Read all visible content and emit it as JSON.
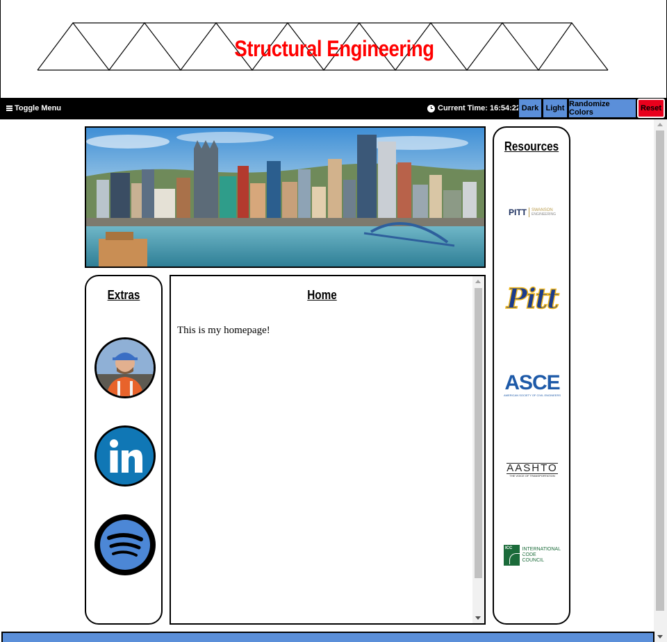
{
  "header": {
    "title": "Structural Engineering",
    "title_color": "#ff0000"
  },
  "navbar": {
    "toggle_label": "Toggle Menu",
    "time_label": "Current Time: 16:54:22",
    "buttons": {
      "dark": "Dark",
      "light": "Light",
      "randomize": "Randomize Colors",
      "reset": "Reset"
    },
    "accent_color": "#5b8fd9",
    "reset_color": "#e8001c"
  },
  "banner": {
    "icon": "city-skyline-image"
  },
  "extras": {
    "title": "Extras",
    "items": [
      {
        "icon": "profile-photo"
      },
      {
        "icon": "linkedin-icon"
      },
      {
        "icon": "spotify-icon"
      }
    ]
  },
  "content": {
    "title": "Home",
    "text": "This is my homepage!"
  },
  "resources": {
    "title": "Resources",
    "logos": {
      "pitt_swanson": {
        "main": "PITT",
        "sub1": "SWANSON",
        "sub2": "ENGINEERING"
      },
      "pitt": "Pitt",
      "asce": {
        "main": "ASCE",
        "sub": "AMERICAN SOCIETY OF CIVIL ENGINEERS"
      },
      "aashto": {
        "main": "AASHTO",
        "sub": "THE VOICE OF TRANSPORTATION"
      },
      "icc": {
        "badge": "ICC",
        "l1": "INTERNATIONAL",
        "l2": "CODE",
        "l3": "COUNCIL"
      }
    }
  }
}
